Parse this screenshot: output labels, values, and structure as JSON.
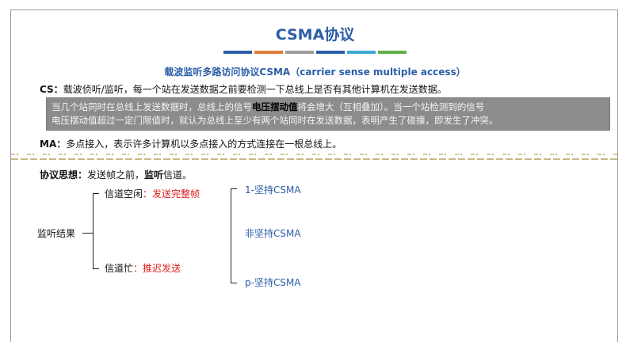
{
  "title": "CSMA协议",
  "title_bar_colors": [
    "#2b5ea7",
    "#e07b39",
    "#9e9e9e",
    "#2b5ea7",
    "#3da9d4",
    "#5fae4a"
  ],
  "subtitle": "载波监听多路访问协议CSMA（carrier sense multiple access）",
  "cs": {
    "label": "CS：",
    "text": "载波侦听/监听，每一个站在发送数据之前要检测一下总线上是否有其他计算机在发送数据。"
  },
  "note": {
    "line1_before": "当几个站同时在总线上发送数据时，总线上的信号",
    "line1_bold": "电压摆动值",
    "line1_after": "将会增大（互相叠加）。当一个站检测到的信号",
    "line2": "电压摆动值超过一定门限值时，就认为总线上至少有两个站同时在发送数据，表明产生了碰撞，即发生了冲突。"
  },
  "ma": {
    "label": "MA：",
    "text": "多点接入，表示许多计算机以多点接入的方式连接在一根总线上。"
  },
  "idea": {
    "label": "协议思想：",
    "text1": "发送帧之前，",
    "bold": "监听",
    "text2": "信道。"
  },
  "tree": {
    "root": "监听结果",
    "idle": "信道空闲",
    "idle_action": "：发送完整帧",
    "busy": "信道忙",
    "busy_action": "：推迟发送",
    "types": [
      "1-坚持CSMA",
      "非坚持CSMA",
      "p-坚持CSMA"
    ]
  }
}
